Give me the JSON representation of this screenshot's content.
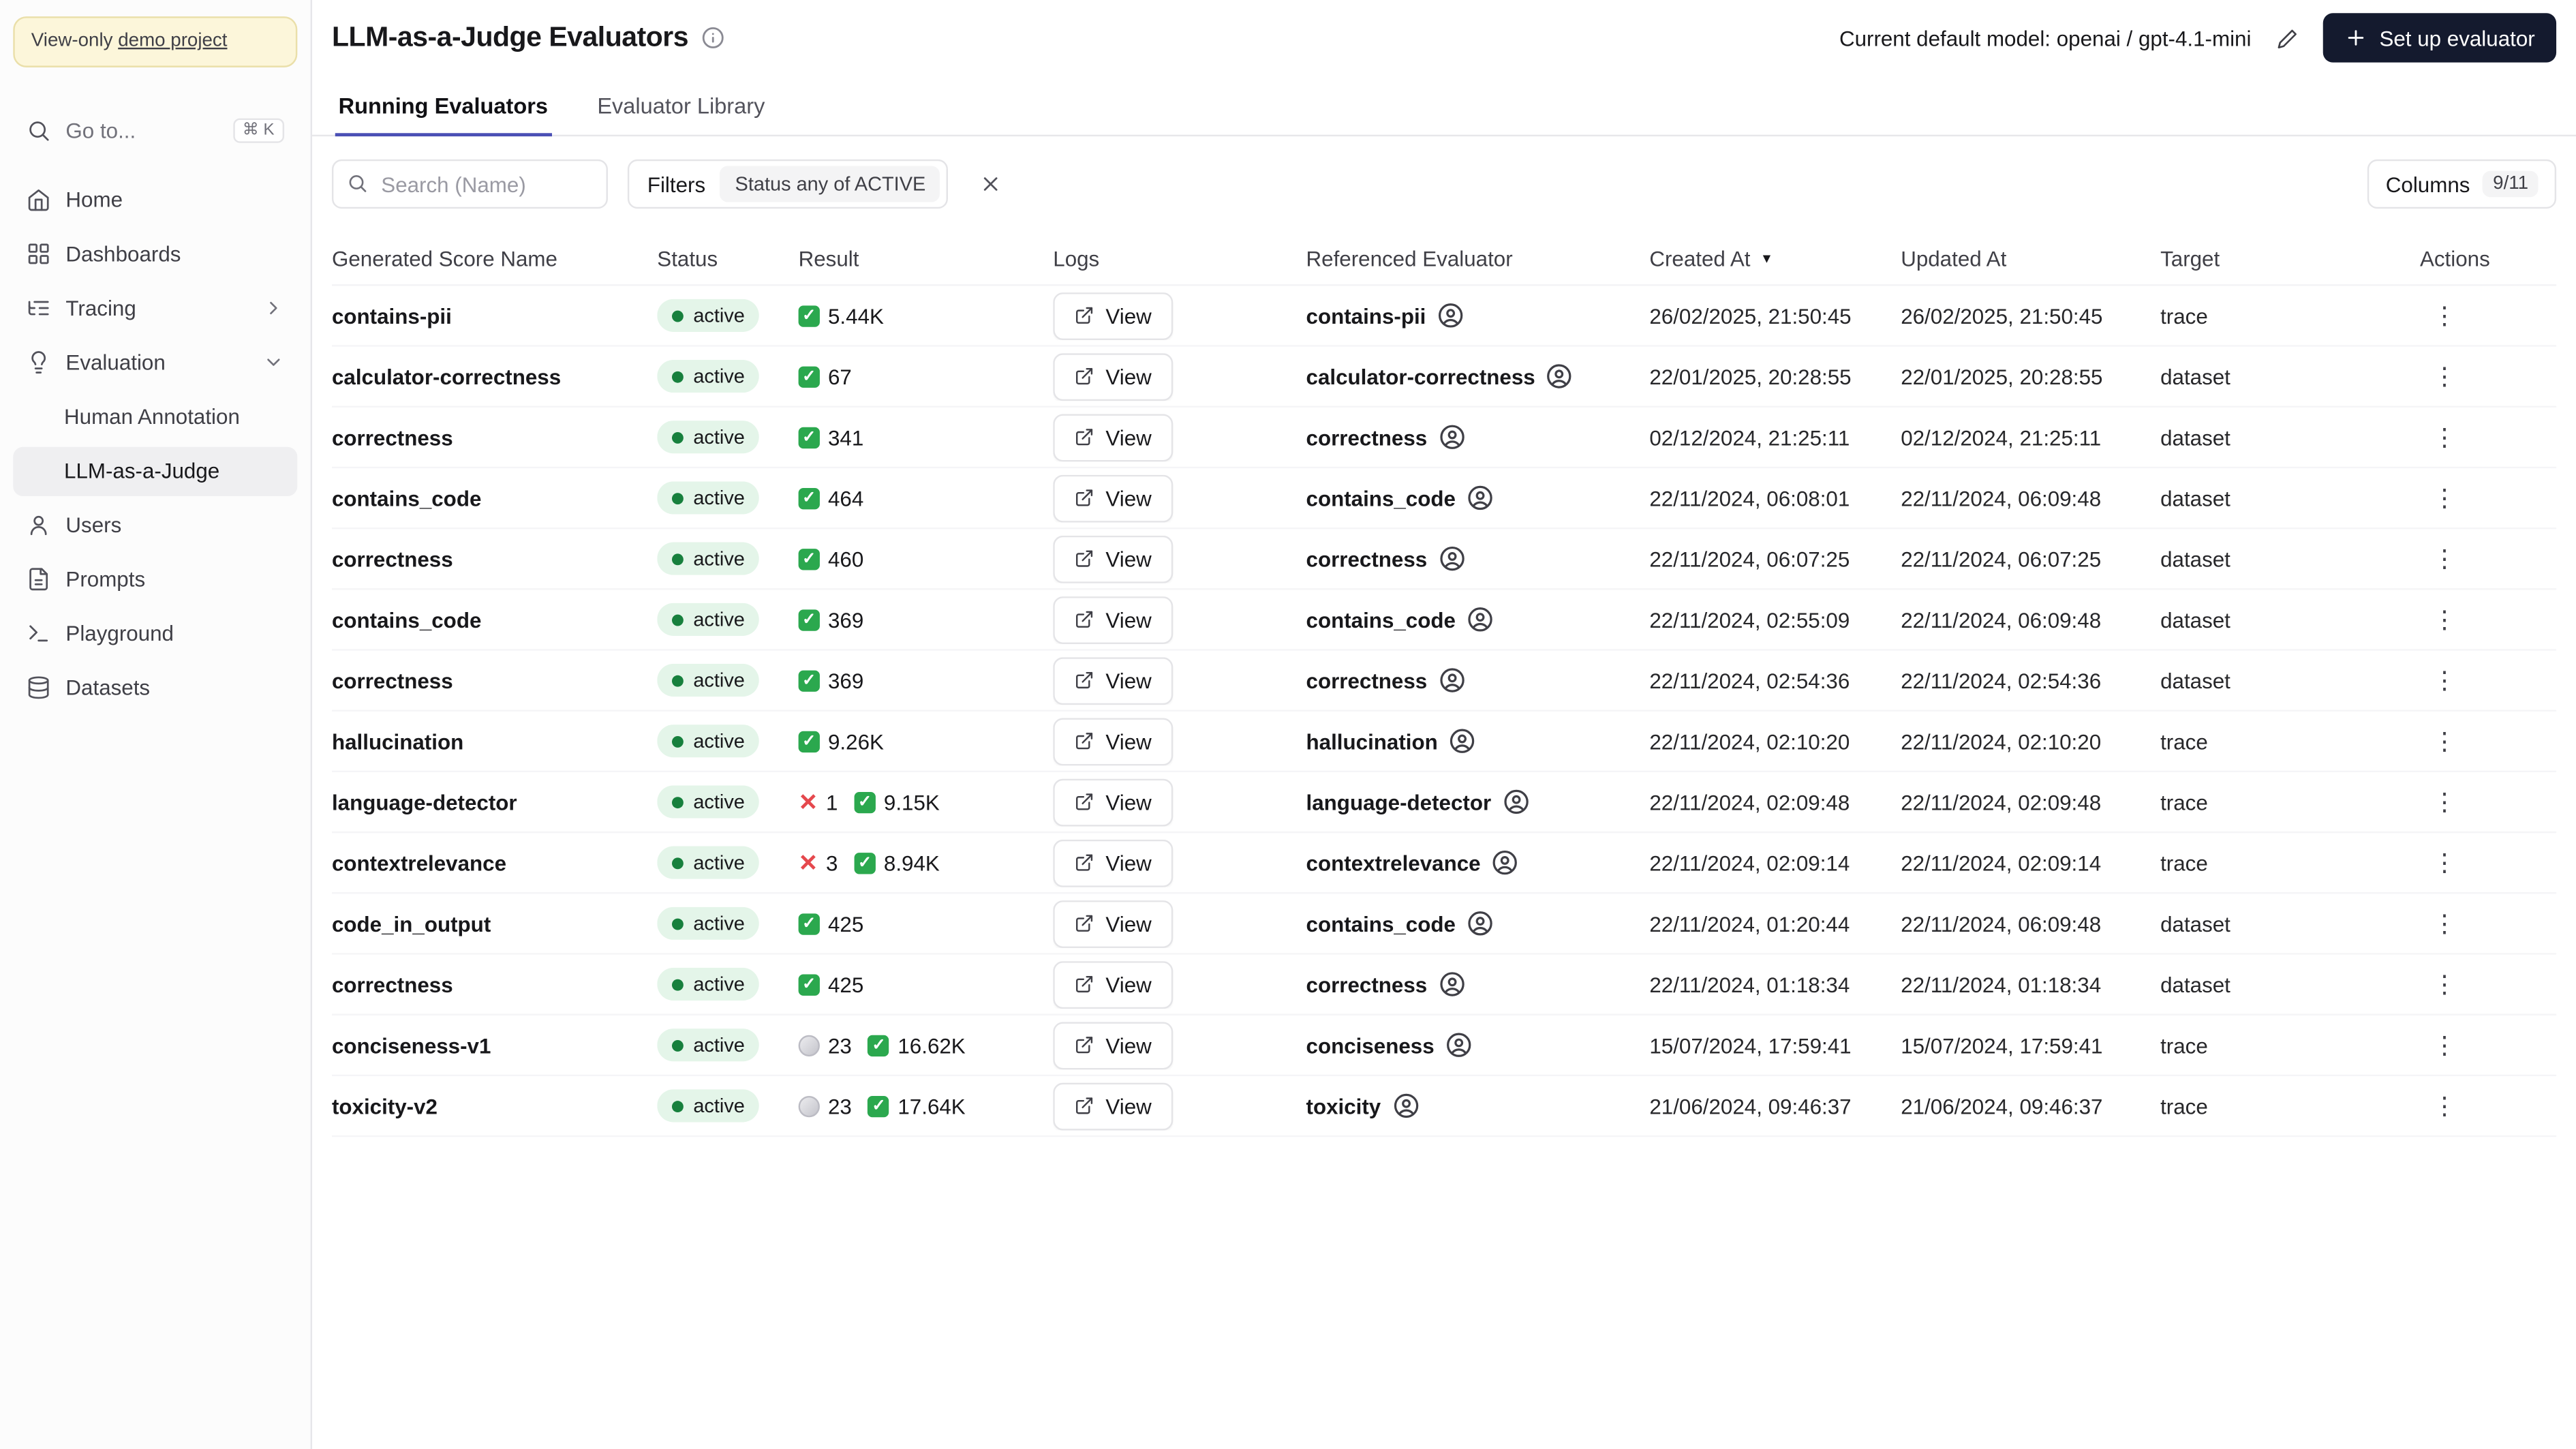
{
  "colors": {
    "accent": "#4a4fb5",
    "primary_dark": "#141a2e",
    "status_bg": "#e4f5e9",
    "status_dot": "#17803d",
    "success": "#2ba84e",
    "error": "#e5484d",
    "banner_bg": "#fcf6da",
    "banner_border": "#eadfa9"
  },
  "icons": {
    "check": "✓",
    "x": "✕",
    "kebab": "⋮",
    "sort_desc": "▼"
  },
  "sidebar": {
    "banner_prefix": "View-only",
    "banner_link": "demo project",
    "goto_label": "Go to...",
    "goto_shortcut": "⌘ K",
    "nav": {
      "home": "Home",
      "dashboards": "Dashboards",
      "tracing": "Tracing",
      "evaluation": "Evaluation",
      "human_annotation": "Human Annotation",
      "llm_judge": "LLM-as-a-Judge",
      "users": "Users",
      "prompts": "Prompts",
      "playground": "Playground",
      "datasets": "Datasets"
    }
  },
  "header": {
    "title": "LLM-as-a-Judge Evaluators",
    "default_model": "Current default model: openai / gpt-4.1-mini",
    "setup_button": "Set up evaluator"
  },
  "tabs": {
    "running": "Running Evaluators",
    "library": "Evaluator Library"
  },
  "toolbar": {
    "search_placeholder": "Search (Name)",
    "filters_label": "Filters",
    "filter_value": "Status any of ACTIVE",
    "columns_label": "Columns",
    "columns_count": "9/11"
  },
  "table": {
    "view_label": "View",
    "columns": [
      "Generated Score Name",
      "Status",
      "Result",
      "Logs",
      "Referenced Evaluator",
      "Created At",
      "Updated At",
      "Target",
      "Actions"
    ],
    "rows": [
      {
        "name": "contains-pii",
        "status": "active",
        "results": [
          {
            "type": "success",
            "value": "5.44K"
          }
        ],
        "referenced": "contains-pii",
        "created": "26/02/2025, 21:50:45",
        "updated": "26/02/2025, 21:50:45",
        "target": "trace"
      },
      {
        "name": "calculator-correctness",
        "status": "active",
        "results": [
          {
            "type": "success",
            "value": "67"
          }
        ],
        "referenced": "calculator-correctness",
        "created": "22/01/2025, 20:28:55",
        "updated": "22/01/2025, 20:28:55",
        "target": "dataset"
      },
      {
        "name": "correctness",
        "status": "active",
        "results": [
          {
            "type": "success",
            "value": "341"
          }
        ],
        "referenced": "correctness",
        "created": "02/12/2024, 21:25:11",
        "updated": "02/12/2024, 21:25:11",
        "target": "dataset"
      },
      {
        "name": "contains_code",
        "status": "active",
        "results": [
          {
            "type": "success",
            "value": "464"
          }
        ],
        "referenced": "contains_code",
        "created": "22/11/2024, 06:08:01",
        "updated": "22/11/2024, 06:09:48",
        "target": "dataset"
      },
      {
        "name": "correctness",
        "status": "active",
        "results": [
          {
            "type": "success",
            "value": "460"
          }
        ],
        "referenced": "correctness",
        "created": "22/11/2024, 06:07:25",
        "updated": "22/11/2024, 06:07:25",
        "target": "dataset"
      },
      {
        "name": "contains_code",
        "status": "active",
        "results": [
          {
            "type": "success",
            "value": "369"
          }
        ],
        "referenced": "contains_code",
        "created": "22/11/2024, 02:55:09",
        "updated": "22/11/2024, 06:09:48",
        "target": "dataset"
      },
      {
        "name": "correctness",
        "status": "active",
        "results": [
          {
            "type": "success",
            "value": "369"
          }
        ],
        "referenced": "correctness",
        "created": "22/11/2024, 02:54:36",
        "updated": "22/11/2024, 02:54:36",
        "target": "dataset"
      },
      {
        "name": "hallucination",
        "status": "active",
        "results": [
          {
            "type": "success",
            "value": "9.26K"
          }
        ],
        "referenced": "hallucination",
        "created": "22/11/2024, 02:10:20",
        "updated": "22/11/2024, 02:10:20",
        "target": "trace"
      },
      {
        "name": "language-detector",
        "status": "active",
        "results": [
          {
            "type": "error",
            "value": "1"
          },
          {
            "type": "success",
            "value": "9.15K"
          }
        ],
        "referenced": "language-detector",
        "created": "22/11/2024, 02:09:48",
        "updated": "22/11/2024, 02:09:48",
        "target": "trace"
      },
      {
        "name": "contextrelevance",
        "status": "active",
        "results": [
          {
            "type": "error",
            "value": "3"
          },
          {
            "type": "success",
            "value": "8.94K"
          }
        ],
        "referenced": "contextrelevance",
        "created": "22/11/2024, 02:09:14",
        "updated": "22/11/2024, 02:09:14",
        "target": "trace"
      },
      {
        "name": "code_in_output",
        "status": "active",
        "results": [
          {
            "type": "success",
            "value": "425"
          }
        ],
        "referenced": "contains_code",
        "created": "22/11/2024, 01:20:44",
        "updated": "22/11/2024, 06:09:48",
        "target": "dataset"
      },
      {
        "name": "correctness",
        "status": "active",
        "results": [
          {
            "type": "success",
            "value": "425"
          }
        ],
        "referenced": "correctness",
        "created": "22/11/2024, 01:18:34",
        "updated": "22/11/2024, 01:18:34",
        "target": "dataset"
      },
      {
        "name": "conciseness-v1",
        "status": "active",
        "results": [
          {
            "type": "pending",
            "value": "23"
          },
          {
            "type": "success",
            "value": "16.62K"
          }
        ],
        "referenced": "conciseness",
        "created": "15/07/2024, 17:59:41",
        "updated": "15/07/2024, 17:59:41",
        "target": "trace"
      },
      {
        "name": "toxicity-v2",
        "status": "active",
        "results": [
          {
            "type": "pending",
            "value": "23"
          },
          {
            "type": "success",
            "value": "17.64K"
          }
        ],
        "referenced": "toxicity",
        "created": "21/06/2024, 09:46:37",
        "updated": "21/06/2024, 09:46:37",
        "target": "trace"
      }
    ]
  }
}
